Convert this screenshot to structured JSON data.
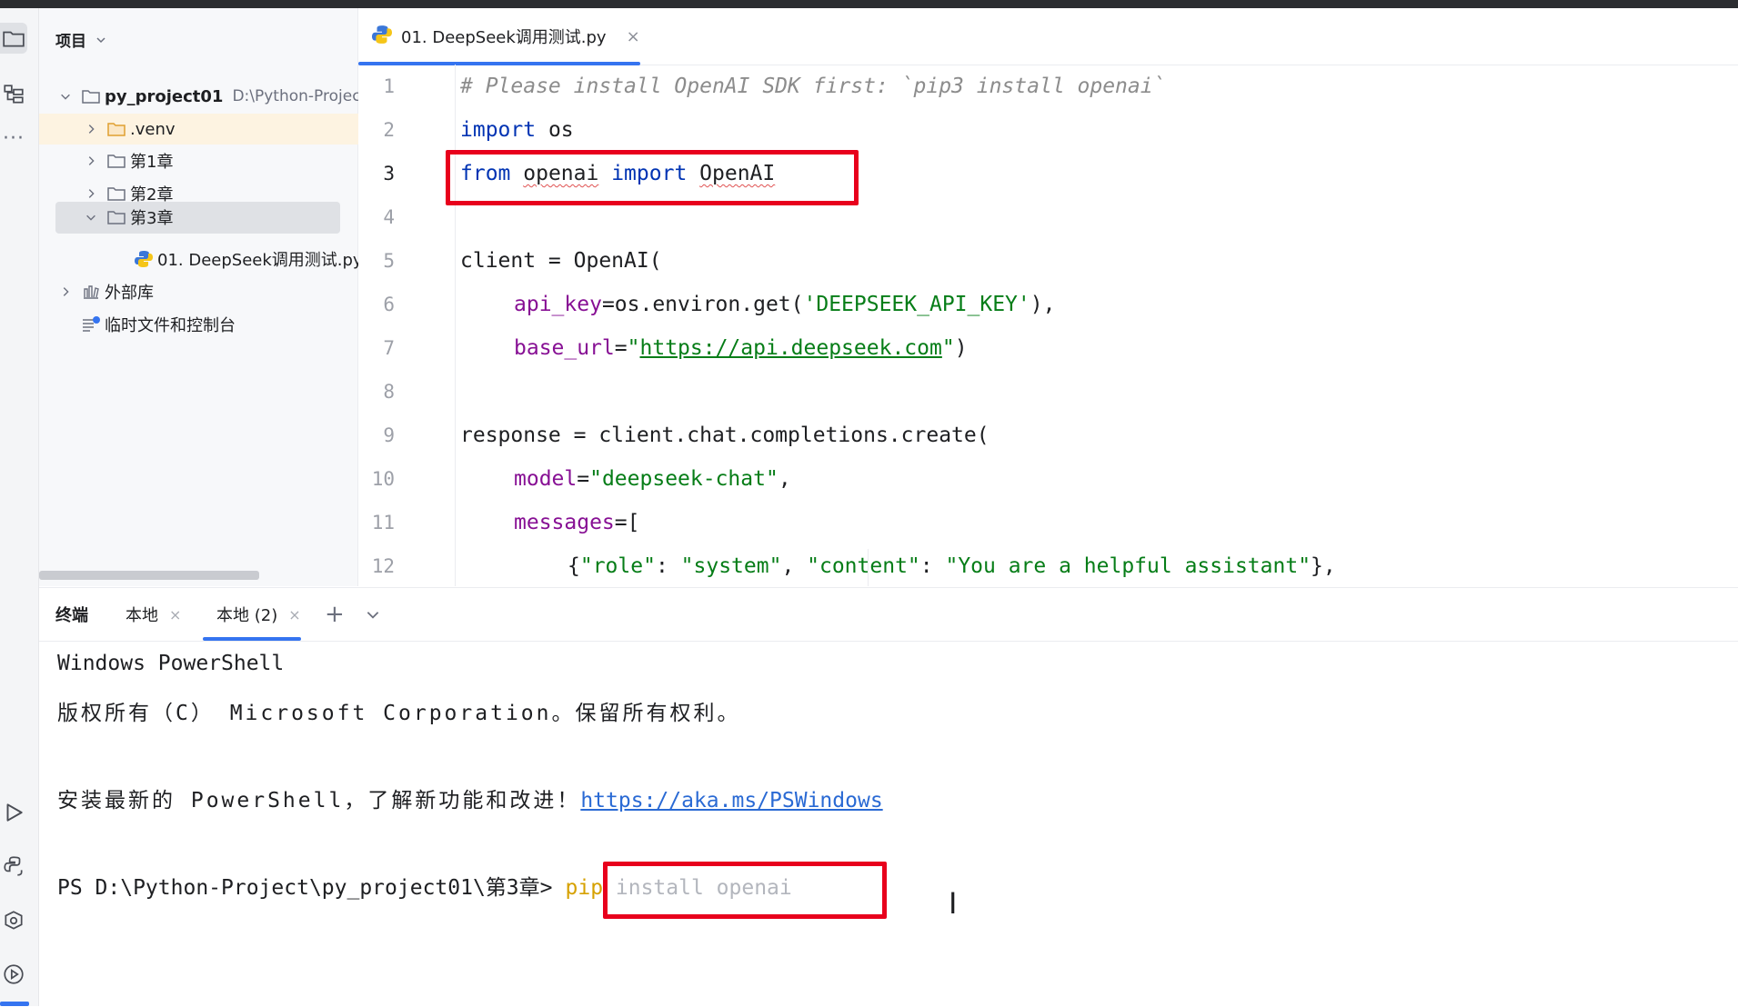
{
  "project_panel": {
    "title": "项目",
    "root": {
      "name": "py_project01",
      "path": "D:\\Python-Projec"
    },
    "items": [
      {
        "label": ".venv"
      },
      {
        "label": "第1章"
      },
      {
        "label": "第2章"
      },
      {
        "label": "第3章"
      },
      {
        "label": "01. DeepSeek调用测试.py"
      },
      {
        "label": "外部库"
      },
      {
        "label": "临时文件和控制台"
      }
    ]
  },
  "editor": {
    "tab": {
      "label": "01. DeepSeek调用测试.py",
      "close": "×"
    },
    "line_numbers": [
      "1",
      "2",
      "3",
      "4",
      "5",
      "6",
      "7",
      "8",
      "9",
      "10",
      "11",
      "12"
    ],
    "code": {
      "l1": "# Please install OpenAI SDK first: `pip3 install openai`",
      "l2_kw": "import",
      "l2_rest": " os",
      "l3_kw1": "from",
      "l3_mod": "openai",
      "l3_kw2": "import",
      "l3_cls": "OpenAI",
      "l5": "client = OpenAI(",
      "l6_param": "api_key",
      "l6_mid": "=os.environ.get(",
      "l6_str": "'DEEPSEEK_API_KEY'",
      "l6_end": "),",
      "l7_param": "base_url",
      "l7_eq": "=",
      "l7_q1": "\"",
      "l7_url": "https://api.deepseek.com",
      "l7_q2": "\"",
      "l7_end": ")",
      "l9": "response = client.chat.completions.create(",
      "l10_param": "model",
      "l10_eq": "=",
      "l10_str": "\"deepseek-chat\"",
      "l10_end": ",",
      "l11_param": "messages",
      "l11_end": "=[",
      "l12_a": "{",
      "l12_k1": "\"role\"",
      "l12_c1": ": ",
      "l12_v1": "\"system\"",
      "l12_c2": ", ",
      "l12_k2": "\"content\"",
      "l12_c3": ": ",
      "l12_v2": "\"You are a helpful assistant\"",
      "l12_end": "},"
    }
  },
  "terminal": {
    "title": "终端",
    "tabs": [
      {
        "label": "本地"
      },
      {
        "label": "本地 (2)"
      }
    ],
    "close": "×",
    "add": "+",
    "lines": {
      "l1": "Windows PowerShell",
      "l2": "版权所有（C） Microsoft Corporation。保留所有权利。",
      "l3_text": "安装最新的 PowerShell，了解新功能和改进！",
      "l3_link": "https://aka.ms/PSWindows",
      "prompt": "PS D:\\Python-Project\\py_project01\\第3章>",
      "cmd_pip": "pip",
      "cmd_rest": " install openai"
    }
  },
  "colors": {
    "highlight_box": "#e8001c",
    "accent": "#3574f0"
  }
}
